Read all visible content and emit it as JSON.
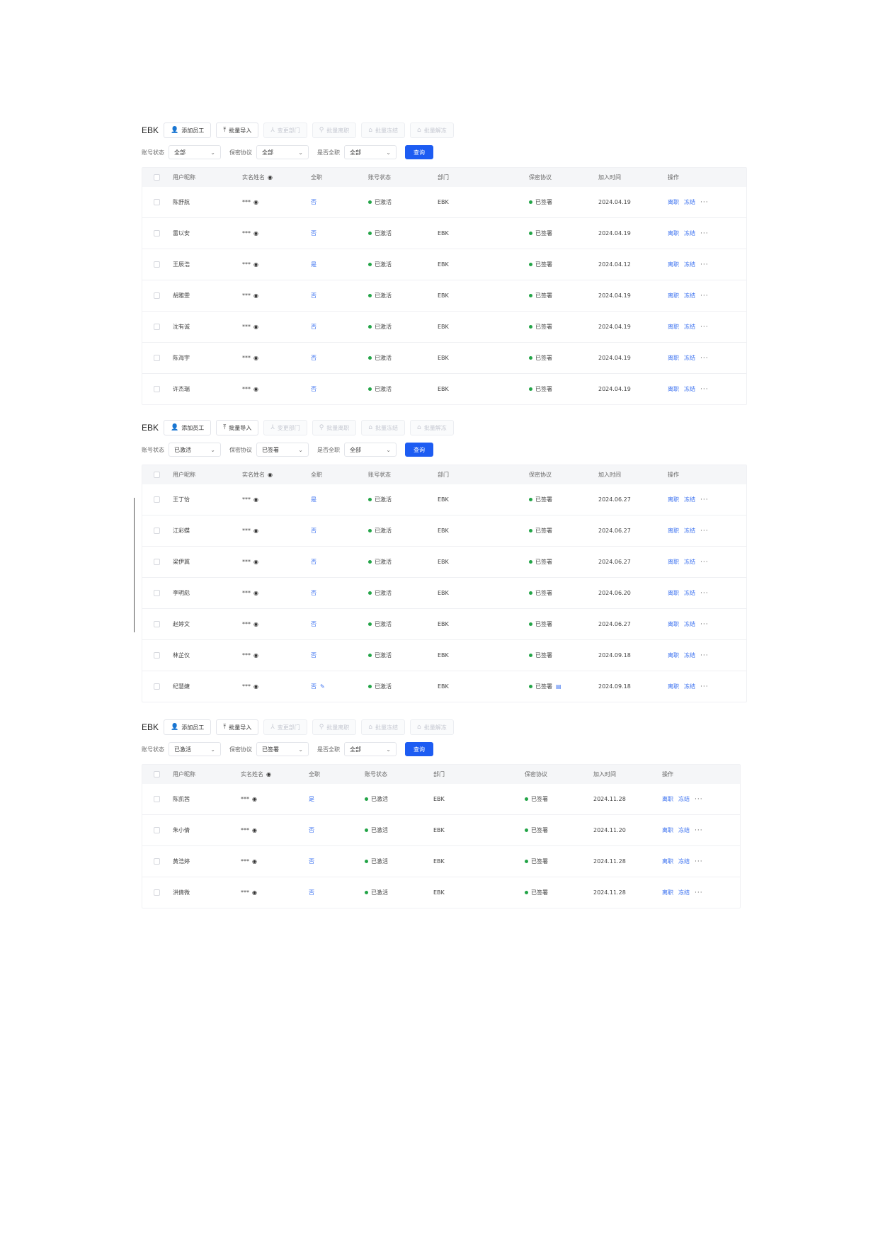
{
  "colors": {
    "primary": "#1d5cf2",
    "link": "#3a70f0",
    "status_dot": "#23a447",
    "header_bg": "#f5f6f8"
  },
  "icons": {
    "add_employee": "user-add-icon",
    "batch_import": "upload-icon",
    "change_dept": "department-icon",
    "batch_resign": "resign-icon",
    "batch_freeze": "freeze-icon",
    "batch_unfreeze": "unfreeze-icon",
    "eye": "eye-icon",
    "chevron": "chevron-down-icon",
    "more": "more-icon",
    "edit": "edit-icon",
    "document": "document-icon"
  },
  "toolbar": {
    "brand": "EBK",
    "add_employee": "添加员工",
    "batch_import": "批量导入",
    "change_dept": "变更部门",
    "batch_resign": "批量离职",
    "batch_freeze": "批量冻结",
    "batch_unfreeze": "批量解冻"
  },
  "filter_labels": {
    "status": "账号状态",
    "confidential": "保密协议",
    "fulltime": "是否全职",
    "query": "查询"
  },
  "columns": {
    "nickname": "用户昵称",
    "realname": "实名姓名",
    "fulltime": "全职",
    "status": "账号状态",
    "dept": "部门",
    "confidential": "保密协议",
    "joined": "加入时间",
    "ops": "操作"
  },
  "ops": {
    "resign": "离职",
    "freeze": "冻结",
    "more": "···"
  },
  "panels": [
    {
      "filters": {
        "status": "全部",
        "confidential": "全部",
        "fulltime": "全部"
      },
      "rows": [
        {
          "name": "陈舒航",
          "masked": "***",
          "fulltime": "否",
          "status": "已激活",
          "dept": "EBK",
          "conf": "已签署",
          "date": "2024.04.19"
        },
        {
          "name": "雷以安",
          "masked": "***",
          "fulltime": "否",
          "status": "已激活",
          "dept": "EBK",
          "conf": "已签署",
          "date": "2024.04.19"
        },
        {
          "name": "王辰浩",
          "masked": "***",
          "fulltime": "是",
          "status": "已激活",
          "dept": "EBK",
          "conf": "已签署",
          "date": "2024.04.12"
        },
        {
          "name": "胡雅雯",
          "masked": "***",
          "fulltime": "否",
          "status": "已激活",
          "dept": "EBK",
          "conf": "已签署",
          "date": "2024.04.19"
        },
        {
          "name": "沈有诚",
          "masked": "***",
          "fulltime": "否",
          "status": "已激活",
          "dept": "EBK",
          "conf": "已签署",
          "date": "2024.04.19"
        },
        {
          "name": "陈海宇",
          "masked": "***",
          "fulltime": "否",
          "status": "已激活",
          "dept": "EBK",
          "conf": "已签署",
          "date": "2024.04.19"
        },
        {
          "name": "许杰瑞",
          "masked": "***",
          "fulltime": "否",
          "status": "已激活",
          "dept": "EBK",
          "conf": "已签署",
          "date": "2024.04.19"
        }
      ]
    },
    {
      "filters": {
        "status": "已激活",
        "confidential": "已签署",
        "fulltime": "全部"
      },
      "rows": [
        {
          "name": "王丁怡",
          "masked": "***",
          "fulltime": "是",
          "status": "已激活",
          "dept": "EBK",
          "conf": "已签署",
          "date": "2024.06.27"
        },
        {
          "name": "江彩蝶",
          "masked": "***",
          "fulltime": "否",
          "status": "已激活",
          "dept": "EBK",
          "conf": "已签署",
          "date": "2024.06.27"
        },
        {
          "name": "梁伊冀",
          "masked": "***",
          "fulltime": "否",
          "status": "已激活",
          "dept": "EBK",
          "conf": "已签署",
          "date": "2024.06.27"
        },
        {
          "name": "李明彪",
          "masked": "***",
          "fulltime": "否",
          "status": "已激活",
          "dept": "EBK",
          "conf": "已签署",
          "date": "2024.06.20"
        },
        {
          "name": "赵婷文",
          "masked": "***",
          "fulltime": "否",
          "status": "已激活",
          "dept": "EBK",
          "conf": "已签署",
          "date": "2024.06.27"
        },
        {
          "name": "林芷仪",
          "masked": "***",
          "fulltime": "否",
          "status": "已激活",
          "dept": "EBK",
          "conf": "已签署",
          "date": "2024.09.18"
        },
        {
          "name": "纪慧婕",
          "masked": "***",
          "fulltime": "否",
          "status": "已激活",
          "dept": "EBK",
          "conf": "已签署",
          "date": "2024.09.18"
        }
      ]
    },
    {
      "filters": {
        "status": "已激活",
        "confidential": "已签署",
        "fulltime": "全部"
      },
      "rows": [
        {
          "name": "陈凯茜",
          "masked": "***",
          "fulltime": "是",
          "status": "已激活",
          "dept": "EBK",
          "conf": "已签署",
          "date": "2024.11.28"
        },
        {
          "name": "朱小倩",
          "masked": "***",
          "fulltime": "否",
          "status": "已激活",
          "dept": "EBK",
          "conf": "已签署",
          "date": "2024.11.20"
        },
        {
          "name": "黄浩婷",
          "masked": "***",
          "fulltime": "否",
          "status": "已激活",
          "dept": "EBK",
          "conf": "已签署",
          "date": "2024.11.28"
        },
        {
          "name": "洪倩微",
          "masked": "***",
          "fulltime": "否",
          "status": "已激活",
          "dept": "EBK",
          "conf": "已签署",
          "date": "2024.11.28"
        }
      ]
    }
  ]
}
